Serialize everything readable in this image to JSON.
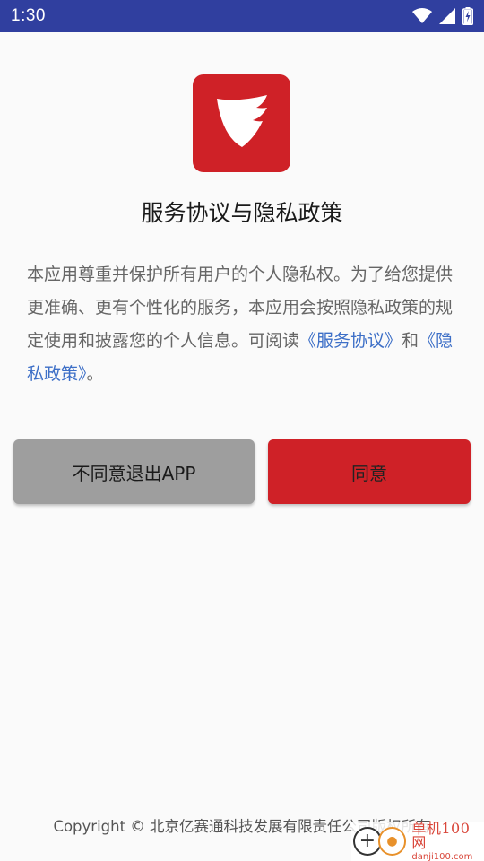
{
  "status_bar": {
    "time": "1:30",
    "icons": [
      "wifi-icon",
      "cellular-signal-icon",
      "battery-charging-icon"
    ]
  },
  "logo": {
    "icon": "shield-wings-logo-icon",
    "color": "#cf2127"
  },
  "title": "服务协议与隐私政策",
  "description": {
    "text": "本应用尊重并保护所有用户的个人隐私权。为了给您提供更准确、更有个性化的服务，本应用会按照隐私政策的规定使用和披露您的个人信息。可阅读",
    "service_link": "《服务协议》",
    "conjunction": "和",
    "privacy_link": "《隐私政策》",
    "end": "。"
  },
  "buttons": {
    "disagree_label": "不同意退出APP",
    "agree_label": "同意"
  },
  "copyright": "Copyright © 北京亿赛通科技发展有限责任公司版权所有",
  "watermark": {
    "name": "单机100网",
    "url": "danji100.com"
  },
  "colors": {
    "status_bar": "#303f9f",
    "primary_red": "#cf2127",
    "disagree_gray": "#9e9e9e",
    "link_blue": "#3d6fc7"
  }
}
